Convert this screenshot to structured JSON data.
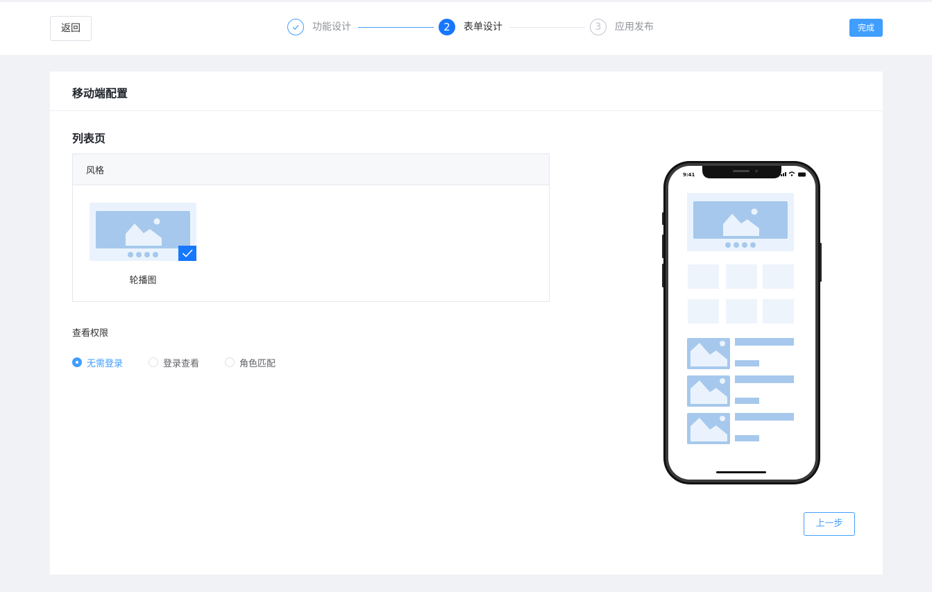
{
  "header": {
    "back_label": "返回",
    "done_label": "完成",
    "steps": [
      {
        "number": "✓",
        "label": "功能设计",
        "status": "finished"
      },
      {
        "number": "2",
        "label": "表单设计",
        "status": "active"
      },
      {
        "number": "3",
        "label": "应用发布",
        "status": "waiting"
      }
    ]
  },
  "card": {
    "title": "移动端配置",
    "section_title": "列表页",
    "style_box": {
      "header": "风格",
      "options": [
        {
          "label": "轮播图",
          "selected": true,
          "icon": "carousel-thumbnail-icon"
        }
      ]
    },
    "permission": {
      "label": "查看权限",
      "options": [
        {
          "label": "无需登录",
          "checked": true
        },
        {
          "label": "登录查看",
          "checked": false
        },
        {
          "label": "角色匹配",
          "checked": false
        }
      ]
    },
    "preview": {
      "status_time": "9:41"
    },
    "prev_label": "上一步"
  },
  "colors": {
    "primary": "#409eff",
    "step_active": "#1677ff",
    "placeholder_dark": "#a6c8ec",
    "placeholder_light": "#eaf3fd"
  }
}
